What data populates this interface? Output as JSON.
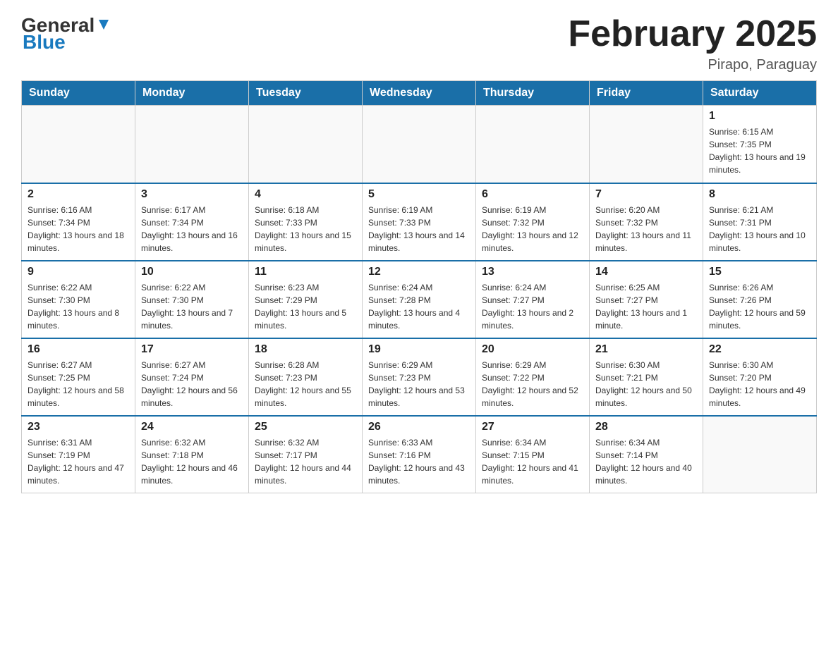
{
  "header": {
    "logo_general": "General",
    "logo_blue": "Blue",
    "title": "February 2025",
    "location": "Pirapo, Paraguay"
  },
  "weekdays": [
    "Sunday",
    "Monday",
    "Tuesday",
    "Wednesday",
    "Thursday",
    "Friday",
    "Saturday"
  ],
  "weeks": [
    [
      {
        "day": "",
        "sunrise": "",
        "sunset": "",
        "daylight": ""
      },
      {
        "day": "",
        "sunrise": "",
        "sunset": "",
        "daylight": ""
      },
      {
        "day": "",
        "sunrise": "",
        "sunset": "",
        "daylight": ""
      },
      {
        "day": "",
        "sunrise": "",
        "sunset": "",
        "daylight": ""
      },
      {
        "day": "",
        "sunrise": "",
        "sunset": "",
        "daylight": ""
      },
      {
        "day": "",
        "sunrise": "",
        "sunset": "",
        "daylight": ""
      },
      {
        "day": "1",
        "sunrise": "Sunrise: 6:15 AM",
        "sunset": "Sunset: 7:35 PM",
        "daylight": "Daylight: 13 hours and 19 minutes."
      }
    ],
    [
      {
        "day": "2",
        "sunrise": "Sunrise: 6:16 AM",
        "sunset": "Sunset: 7:34 PM",
        "daylight": "Daylight: 13 hours and 18 minutes."
      },
      {
        "day": "3",
        "sunrise": "Sunrise: 6:17 AM",
        "sunset": "Sunset: 7:34 PM",
        "daylight": "Daylight: 13 hours and 16 minutes."
      },
      {
        "day": "4",
        "sunrise": "Sunrise: 6:18 AM",
        "sunset": "Sunset: 7:33 PM",
        "daylight": "Daylight: 13 hours and 15 minutes."
      },
      {
        "day": "5",
        "sunrise": "Sunrise: 6:19 AM",
        "sunset": "Sunset: 7:33 PM",
        "daylight": "Daylight: 13 hours and 14 minutes."
      },
      {
        "day": "6",
        "sunrise": "Sunrise: 6:19 AM",
        "sunset": "Sunset: 7:32 PM",
        "daylight": "Daylight: 13 hours and 12 minutes."
      },
      {
        "day": "7",
        "sunrise": "Sunrise: 6:20 AM",
        "sunset": "Sunset: 7:32 PM",
        "daylight": "Daylight: 13 hours and 11 minutes."
      },
      {
        "day": "8",
        "sunrise": "Sunrise: 6:21 AM",
        "sunset": "Sunset: 7:31 PM",
        "daylight": "Daylight: 13 hours and 10 minutes."
      }
    ],
    [
      {
        "day": "9",
        "sunrise": "Sunrise: 6:22 AM",
        "sunset": "Sunset: 7:30 PM",
        "daylight": "Daylight: 13 hours and 8 minutes."
      },
      {
        "day": "10",
        "sunrise": "Sunrise: 6:22 AM",
        "sunset": "Sunset: 7:30 PM",
        "daylight": "Daylight: 13 hours and 7 minutes."
      },
      {
        "day": "11",
        "sunrise": "Sunrise: 6:23 AM",
        "sunset": "Sunset: 7:29 PM",
        "daylight": "Daylight: 13 hours and 5 minutes."
      },
      {
        "day": "12",
        "sunrise": "Sunrise: 6:24 AM",
        "sunset": "Sunset: 7:28 PM",
        "daylight": "Daylight: 13 hours and 4 minutes."
      },
      {
        "day": "13",
        "sunrise": "Sunrise: 6:24 AM",
        "sunset": "Sunset: 7:27 PM",
        "daylight": "Daylight: 13 hours and 2 minutes."
      },
      {
        "day": "14",
        "sunrise": "Sunrise: 6:25 AM",
        "sunset": "Sunset: 7:27 PM",
        "daylight": "Daylight: 13 hours and 1 minute."
      },
      {
        "day": "15",
        "sunrise": "Sunrise: 6:26 AM",
        "sunset": "Sunset: 7:26 PM",
        "daylight": "Daylight: 12 hours and 59 minutes."
      }
    ],
    [
      {
        "day": "16",
        "sunrise": "Sunrise: 6:27 AM",
        "sunset": "Sunset: 7:25 PM",
        "daylight": "Daylight: 12 hours and 58 minutes."
      },
      {
        "day": "17",
        "sunrise": "Sunrise: 6:27 AM",
        "sunset": "Sunset: 7:24 PM",
        "daylight": "Daylight: 12 hours and 56 minutes."
      },
      {
        "day": "18",
        "sunrise": "Sunrise: 6:28 AM",
        "sunset": "Sunset: 7:23 PM",
        "daylight": "Daylight: 12 hours and 55 minutes."
      },
      {
        "day": "19",
        "sunrise": "Sunrise: 6:29 AM",
        "sunset": "Sunset: 7:23 PM",
        "daylight": "Daylight: 12 hours and 53 minutes."
      },
      {
        "day": "20",
        "sunrise": "Sunrise: 6:29 AM",
        "sunset": "Sunset: 7:22 PM",
        "daylight": "Daylight: 12 hours and 52 minutes."
      },
      {
        "day": "21",
        "sunrise": "Sunrise: 6:30 AM",
        "sunset": "Sunset: 7:21 PM",
        "daylight": "Daylight: 12 hours and 50 minutes."
      },
      {
        "day": "22",
        "sunrise": "Sunrise: 6:30 AM",
        "sunset": "Sunset: 7:20 PM",
        "daylight": "Daylight: 12 hours and 49 minutes."
      }
    ],
    [
      {
        "day": "23",
        "sunrise": "Sunrise: 6:31 AM",
        "sunset": "Sunset: 7:19 PM",
        "daylight": "Daylight: 12 hours and 47 minutes."
      },
      {
        "day": "24",
        "sunrise": "Sunrise: 6:32 AM",
        "sunset": "Sunset: 7:18 PM",
        "daylight": "Daylight: 12 hours and 46 minutes."
      },
      {
        "day": "25",
        "sunrise": "Sunrise: 6:32 AM",
        "sunset": "Sunset: 7:17 PM",
        "daylight": "Daylight: 12 hours and 44 minutes."
      },
      {
        "day": "26",
        "sunrise": "Sunrise: 6:33 AM",
        "sunset": "Sunset: 7:16 PM",
        "daylight": "Daylight: 12 hours and 43 minutes."
      },
      {
        "day": "27",
        "sunrise": "Sunrise: 6:34 AM",
        "sunset": "Sunset: 7:15 PM",
        "daylight": "Daylight: 12 hours and 41 minutes."
      },
      {
        "day": "28",
        "sunrise": "Sunrise: 6:34 AM",
        "sunset": "Sunset: 7:14 PM",
        "daylight": "Daylight: 12 hours and 40 minutes."
      },
      {
        "day": "",
        "sunrise": "",
        "sunset": "",
        "daylight": ""
      }
    ]
  ]
}
